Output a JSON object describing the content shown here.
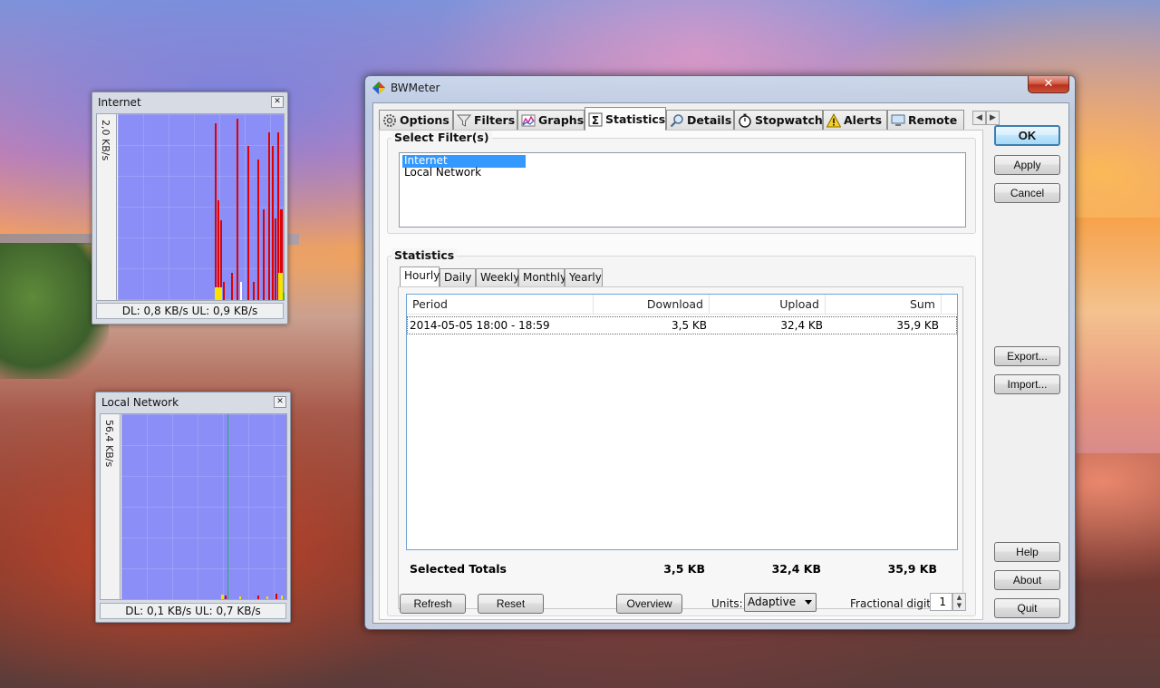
{
  "internet_meter": {
    "title": "Internet",
    "scale": "2,0 KB/s",
    "status": "DL: 0,8 KB/s   UL: 0,9 KB/s"
  },
  "local_meter": {
    "title": "Local Network",
    "scale": "56,4 KB/s",
    "status": "DL: 0,1 KB/s   UL: 0,7 KB/s"
  },
  "window": {
    "title": "BWMeter",
    "close_glyph": "✕"
  },
  "tabs": [
    {
      "label": "Options",
      "icon": "gear-icon"
    },
    {
      "label": "Filters",
      "icon": "funnel-icon"
    },
    {
      "label": "Graphs",
      "icon": "graph-icon"
    },
    {
      "label": "Statistics",
      "icon": "sigma-icon",
      "active": true
    },
    {
      "label": "Details",
      "icon": "magnifier-icon"
    },
    {
      "label": "Stopwatch",
      "icon": "stopwatch-icon"
    },
    {
      "label": "Alerts",
      "icon": "warning-icon"
    },
    {
      "label": "Remote",
      "icon": "monitor-icon"
    }
  ],
  "tab_scroll": {
    "left": "◀",
    "right": "▶"
  },
  "filters": {
    "label": "Select Filter(s)",
    "items": [
      "Internet",
      "Local Network"
    ],
    "selected": "Internet"
  },
  "statistics": {
    "label": "Statistics",
    "tabs": [
      "Hourly",
      "Daily",
      "Weekly",
      "Monthly",
      "Yearly"
    ],
    "active_tab": "Hourly",
    "columns": [
      "Period",
      "Download",
      "Upload",
      "Sum"
    ],
    "rows": [
      {
        "period": "2014-05-05  18:00 - 18:59",
        "download": "3,5 KB",
        "upload": "32,4 KB",
        "sum": "35,9 KB"
      }
    ],
    "totals": {
      "label": "Selected Totals",
      "download": "3,5 KB",
      "upload": "32,4 KB",
      "sum": "35,9 KB"
    }
  },
  "bottom": {
    "refresh": "Refresh",
    "reset": "Reset",
    "overview": "Overview",
    "units_label": "Units:",
    "units_value": "Adaptive",
    "fractional_label": "Fractional digits:",
    "fractional_value": "1"
  },
  "side_buttons": {
    "ok": "OK",
    "apply": "Apply",
    "cancel": "Cancel",
    "export": "Export...",
    "import": "Import...",
    "help": "Help",
    "about": "About",
    "quit": "Quit"
  }
}
